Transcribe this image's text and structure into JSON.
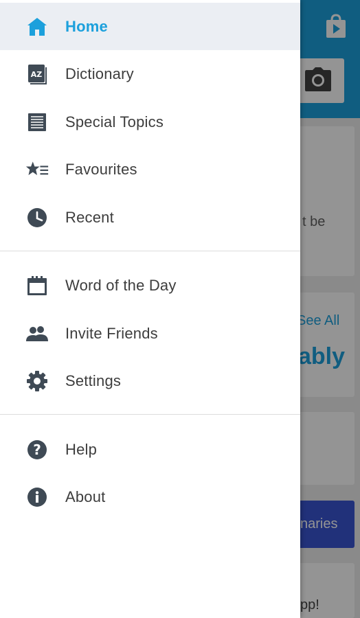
{
  "background": {
    "partial_card_text": "t be",
    "see_all_label": "See All",
    "partial_word": "ably",
    "partial_button_text": "naries",
    "partial_footer_text": "pp!"
  },
  "drawer": {
    "groups": [
      [
        {
          "label": "Home",
          "icon": "home-icon",
          "active": true
        },
        {
          "label": "Dictionary",
          "icon": "dictionary-az-icon"
        },
        {
          "label": "Special Topics",
          "icon": "topics-list-icon"
        },
        {
          "label": "Favourites",
          "icon": "favourites-star-icon"
        },
        {
          "label": "Recent",
          "icon": "clock-icon"
        }
      ],
      [
        {
          "label": "Word of the Day",
          "icon": "calendar-icon"
        },
        {
          "label": "Invite Friends",
          "icon": "people-icon"
        },
        {
          "label": "Settings",
          "icon": "gear-icon"
        }
      ],
      [
        {
          "label": "Help",
          "icon": "help-icon"
        },
        {
          "label": "About",
          "icon": "info-icon"
        }
      ]
    ]
  },
  "colors": {
    "accent": "#1ca0dc",
    "active_background": "#ebeef3",
    "icon": "#3f4a55",
    "label": "#3d3d3d"
  }
}
